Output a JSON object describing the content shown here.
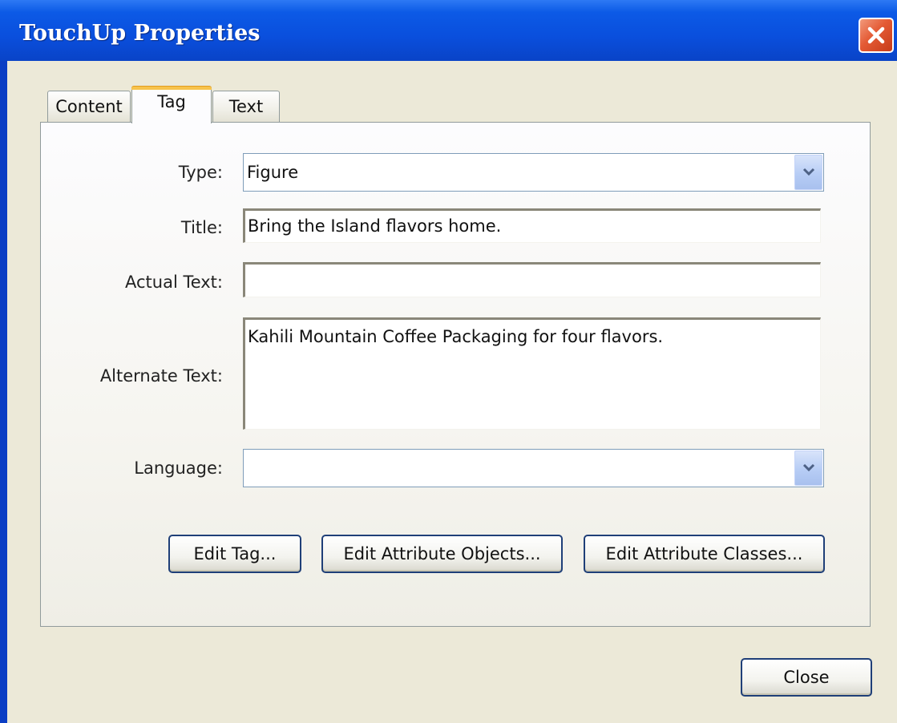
{
  "window": {
    "title": "TouchUp Properties",
    "colors": {
      "titlebar": "#0a4fdd",
      "close_button": "#e45a34",
      "face": "#ece9d8",
      "active_tab_accent": "#f7c34c"
    }
  },
  "tabs": [
    {
      "label": "Content",
      "active": false
    },
    {
      "label": "Tag",
      "active": true
    },
    {
      "label": "Text",
      "active": false
    }
  ],
  "form": {
    "type_label": "Type:",
    "type_value": "Figure",
    "title_label": "Title:",
    "title_value": "Bring the Island flavors home.",
    "actual_text_label": "Actual Text:",
    "actual_text_value": "",
    "alternate_text_label": "Alternate Text:",
    "alternate_text_value": "Kahili Mountain Coffee Packaging for four flavors.",
    "language_label": "Language:",
    "language_value": ""
  },
  "buttons": {
    "edit_tag": "Edit Tag...",
    "edit_attribute_objects": "Edit Attribute Objects...",
    "edit_attribute_classes": "Edit Attribute Classes...",
    "close": "Close"
  },
  "icons": {
    "close": "close-x-icon",
    "dropdown": "chevron-down-icon"
  }
}
